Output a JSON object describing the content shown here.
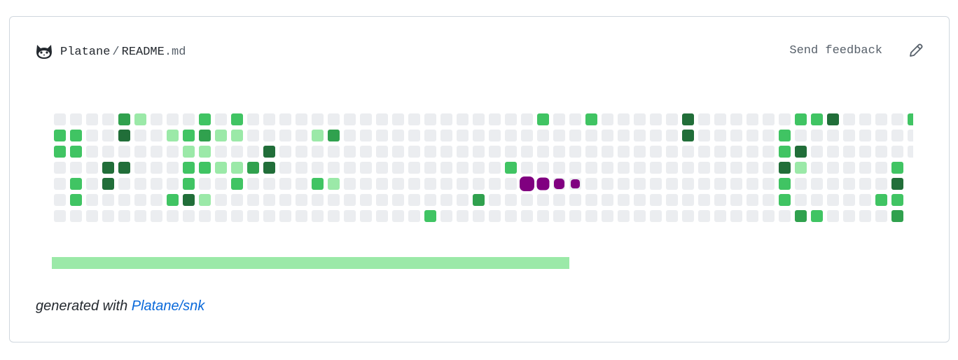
{
  "header": {
    "owner": "Platane",
    "separator": "/",
    "filename": "README",
    "extension": ".md",
    "owner_icon": "cat-face-icon"
  },
  "actions": {
    "feedback_label": "Send feedback",
    "edit_icon": "pencil-icon"
  },
  "contribution_grid": {
    "colors": {
      "0": "#ebedf0",
      "1": "#9be9a8",
      "2": "#40c463",
      "3": "#30a14e",
      "4": "#216e39"
    },
    "snake_color": "#800080",
    "rows": [
      "00003100020200000000000000000000000000000000000000000000000000000000000000000000000000000000000000000000000000000000000000000000000000000000000000000000000000000000000000000000000000",
      "2200400000000000000000000000000000000000000000000000000000000000000000000000000000000000000000000000000000000000000000000000000000000000000000000000000000000000000000000000000000000000"
    ]
  },
  "grid": {
    "cols": 54,
    "rows_data": [
      "000031000202000000000000000000200200000400000022400002",
      "220040012311000013000000000000000000000400000200000000",
      "220000001100040000000000000000000000000000000240000000",
      "000440002211340000000000000020000000000000000410000020",
      "020400002002000021000000000000000000000000000200000040",
      "020000024100000000000000003000000000000000000200000220",
      "000000000000000000000002000000000000000000000032000030"
    ],
    "row_lengths": [
      54,
      54,
      54,
      53,
      53,
      53,
      53
    ],
    "snake": [
      {
        "col": 29,
        "row": 4,
        "size": "large"
      },
      {
        "col": 30,
        "row": 4,
        "size": "medium"
      },
      {
        "col": 31,
        "row": 4,
        "size": "small"
      },
      {
        "col": 32,
        "row": 4,
        "size": "xsmall"
      }
    ]
  },
  "progress": {
    "fraction": 0.54,
    "color": "#9be9a8"
  },
  "footer": {
    "prefix": "generated with",
    "link_text": "Platane/snk"
  }
}
